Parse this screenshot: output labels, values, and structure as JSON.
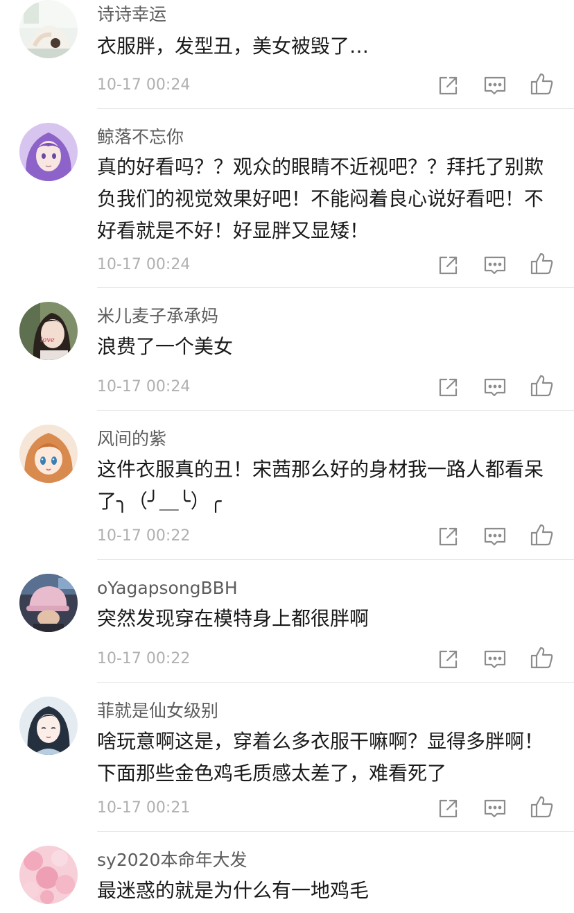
{
  "comments": [
    {
      "username": "诗诗幸运",
      "text": "衣服胖，发型丑，美女被毁了…",
      "time": "10-17 00:24",
      "avatar": "avatar-yoga-pose-photo"
    },
    {
      "username": "鲸落不忘你",
      "text": "真的好看吗？？观众的眼睛不近视吧？？拜托了别欺负我们的视觉效果好吧！不能闷着良心说好看吧！不好看就是不好！好显胖又显矮！",
      "time": "10-17 00:24",
      "avatar": "avatar-purple-hair-anime"
    },
    {
      "username": "米儿麦子承承妈",
      "text": "浪费了一个美女",
      "time": "10-17 00:24",
      "avatar": "avatar-woman-selfie-love"
    },
    {
      "username": "风间的紫",
      "text": "这件衣服真的丑！宋茜那么好的身材我一路人都看呆了╮（╯＿╰）╭",
      "time": "10-17 00:22",
      "avatar": "avatar-anime-girl-brown-hair"
    },
    {
      "username": "oYagapsongBBH",
      "text": "突然发现穿在模特身上都很胖啊",
      "time": "10-17 00:22",
      "avatar": "avatar-pink-hat-photo"
    },
    {
      "username": "菲就是仙女级别",
      "text": "啥玩意啊这是，穿着么多衣服干嘛啊？显得多胖啊！下面那些金色鸡毛质感太差了，难看死了",
      "time": "10-17 00:21",
      "avatar": "avatar-illustrated-girl"
    },
    {
      "username": "sy2020本命年大发",
      "text": "最迷惑的就是为什么有一地鸡毛",
      "time": "",
      "avatar": "avatar-pink-blossoms"
    }
  ],
  "actions": {
    "share_icon": "share-icon",
    "reply_icon": "reply-icon",
    "like_icon": "thumbs-up-icon"
  },
  "colors": {
    "username": "#5c5c5c",
    "content": "#1a1a1a",
    "time": "#b0b0b0",
    "icon": "#8c8c8c",
    "divider": "#e8e8e8"
  }
}
